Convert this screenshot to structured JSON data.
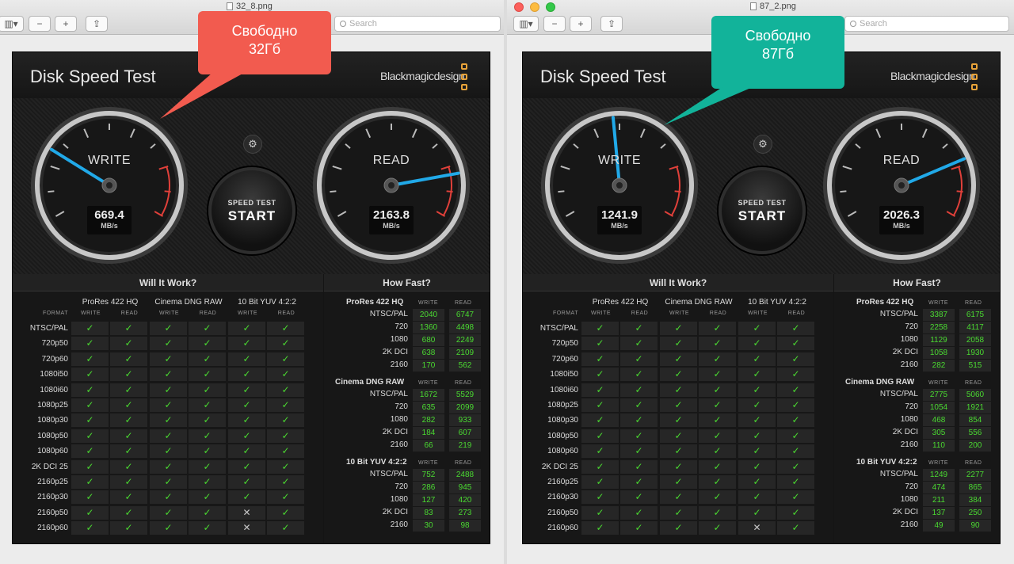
{
  "windows": [
    {
      "filename": "32_8.png",
      "search_placeholder": "Search",
      "traffic_lights": false,
      "app": {
        "title": "Disk Speed Test",
        "brand": "Blackmagicdesign",
        "write": {
          "label": "WRITE",
          "value": "669.4",
          "unit": "MB/s",
          "needle_mbps": 669.4
        },
        "read": {
          "label": "READ",
          "value": "2163.8",
          "unit": "MB/s",
          "needle_mbps": 2163.8
        },
        "start_top": "SPEED TEST",
        "start_main": "START"
      },
      "callout": {
        "line1": "Свободно",
        "line2": "32Гб",
        "color": "#f25b4f"
      },
      "will_it_work": {
        "title": "Will It Work?",
        "groups": [
          "ProRes 422 HQ",
          "Cinema DNG RAW",
          "10 Bit YUV 4:2:2"
        ],
        "format_label": "FORMAT",
        "write_label": "WRITE",
        "read_label": "READ",
        "rows": [
          {
            "label": "NTSC/PAL",
            "cells": [
              1,
              1,
              1,
              1,
              1,
              1
            ]
          },
          {
            "label": "720p50",
            "cells": [
              1,
              1,
              1,
              1,
              1,
              1
            ]
          },
          {
            "label": "720p60",
            "cells": [
              1,
              1,
              1,
              1,
              1,
              1
            ]
          },
          {
            "label": "1080i50",
            "cells": [
              1,
              1,
              1,
              1,
              1,
              1
            ]
          },
          {
            "label": "1080i60",
            "cells": [
              1,
              1,
              1,
              1,
              1,
              1
            ]
          },
          {
            "label": "1080p25",
            "cells": [
              1,
              1,
              1,
              1,
              1,
              1
            ]
          },
          {
            "label": "1080p30",
            "cells": [
              1,
              1,
              1,
              1,
              1,
              1
            ]
          },
          {
            "label": "1080p50",
            "cells": [
              1,
              1,
              1,
              1,
              1,
              1
            ]
          },
          {
            "label": "1080p60",
            "cells": [
              1,
              1,
              1,
              1,
              1,
              1
            ]
          },
          {
            "label": "2K DCI 25",
            "cells": [
              1,
              1,
              1,
              1,
              1,
              1
            ]
          },
          {
            "label": "2160p25",
            "cells": [
              1,
              1,
              1,
              1,
              1,
              1
            ]
          },
          {
            "label": "2160p30",
            "cells": [
              1,
              1,
              1,
              1,
              1,
              1
            ]
          },
          {
            "label": "2160p50",
            "cells": [
              1,
              1,
              1,
              1,
              0,
              1
            ]
          },
          {
            "label": "2160p60",
            "cells": [
              1,
              1,
              1,
              1,
              0,
              1
            ]
          }
        ]
      },
      "how_fast": {
        "title": "How Fast?",
        "groups": [
          {
            "name": "ProRes 422 HQ",
            "rows": [
              [
                "NTSC/PAL",
                "2040",
                "6747"
              ],
              [
                "720",
                "1360",
                "4498"
              ],
              [
                "1080",
                "680",
                "2249"
              ],
              [
                "2K DCI",
                "638",
                "2109"
              ],
              [
                "2160",
                "170",
                "562"
              ]
            ]
          },
          {
            "name": "Cinema DNG RAW",
            "rows": [
              [
                "NTSC/PAL",
                "1672",
                "5529"
              ],
              [
                "720",
                "635",
                "2099"
              ],
              [
                "1080",
                "282",
                "933"
              ],
              [
                "2K DCI",
                "184",
                "607"
              ],
              [
                "2160",
                "66",
                "219"
              ]
            ]
          },
          {
            "name": "10 Bit YUV 4:2:2",
            "rows": [
              [
                "NTSC/PAL",
                "752",
                "2488"
              ],
              [
                "720",
                "286",
                "945"
              ],
              [
                "1080",
                "127",
                "420"
              ],
              [
                "2K DCI",
                "83",
                "273"
              ],
              [
                "2160",
                "30",
                "98"
              ]
            ]
          }
        ]
      }
    },
    {
      "filename": "87_2.png",
      "search_placeholder": "Search",
      "traffic_lights": true,
      "app": {
        "title": "Disk Speed Test",
        "brand": "Blackmagicdesign",
        "write": {
          "label": "WRITE",
          "value": "1241.9",
          "unit": "MB/s",
          "needle_mbps": 1241.9
        },
        "read": {
          "label": "READ",
          "value": "2026.3",
          "unit": "MB/s",
          "needle_mbps": 2026.3
        },
        "start_top": "SPEED TEST",
        "start_main": "START"
      },
      "callout": {
        "line1": "Свободно",
        "line2": "87Гб",
        "color": "#12b39a"
      },
      "will_it_work": {
        "title": "Will It Work?",
        "groups": [
          "ProRes 422 HQ",
          "Cinema DNG RAW",
          "10 Bit YUV 4:2:2"
        ],
        "format_label": "FORMAT",
        "write_label": "WRITE",
        "read_label": "READ",
        "rows": [
          {
            "label": "NTSC/PAL",
            "cells": [
              1,
              1,
              1,
              1,
              1,
              1
            ]
          },
          {
            "label": "720p50",
            "cells": [
              1,
              1,
              1,
              1,
              1,
              1
            ]
          },
          {
            "label": "720p60",
            "cells": [
              1,
              1,
              1,
              1,
              1,
              1
            ]
          },
          {
            "label": "1080i50",
            "cells": [
              1,
              1,
              1,
              1,
              1,
              1
            ]
          },
          {
            "label": "1080i60",
            "cells": [
              1,
              1,
              1,
              1,
              1,
              1
            ]
          },
          {
            "label": "1080p25",
            "cells": [
              1,
              1,
              1,
              1,
              1,
              1
            ]
          },
          {
            "label": "1080p30",
            "cells": [
              1,
              1,
              1,
              1,
              1,
              1
            ]
          },
          {
            "label": "1080p50",
            "cells": [
              1,
              1,
              1,
              1,
              1,
              1
            ]
          },
          {
            "label": "1080p60",
            "cells": [
              1,
              1,
              1,
              1,
              1,
              1
            ]
          },
          {
            "label": "2K DCI 25",
            "cells": [
              1,
              1,
              1,
              1,
              1,
              1
            ]
          },
          {
            "label": "2160p25",
            "cells": [
              1,
              1,
              1,
              1,
              1,
              1
            ]
          },
          {
            "label": "2160p30",
            "cells": [
              1,
              1,
              1,
              1,
              1,
              1
            ]
          },
          {
            "label": "2160p50",
            "cells": [
              1,
              1,
              1,
              1,
              1,
              1
            ]
          },
          {
            "label": "2160p60",
            "cells": [
              1,
              1,
              1,
              1,
              0,
              1
            ]
          }
        ]
      },
      "how_fast": {
        "title": "How Fast?",
        "groups": [
          {
            "name": "ProRes 422 HQ",
            "rows": [
              [
                "NTSC/PAL",
                "3387",
                "6175"
              ],
              [
                "720",
                "2258",
                "4117"
              ],
              [
                "1080",
                "1129",
                "2058"
              ],
              [
                "2K DCI",
                "1058",
                "1930"
              ],
              [
                "2160",
                "282",
                "515"
              ]
            ]
          },
          {
            "name": "Cinema DNG RAW",
            "rows": [
              [
                "NTSC/PAL",
                "2775",
                "5060"
              ],
              [
                "720",
                "1054",
                "1921"
              ],
              [
                "1080",
                "468",
                "854"
              ],
              [
                "2K DCI",
                "305",
                "556"
              ],
              [
                "2160",
                "110",
                "200"
              ]
            ]
          },
          {
            "name": "10 Bit YUV 4:2:2",
            "rows": [
              [
                "NTSC/PAL",
                "1249",
                "2277"
              ],
              [
                "720",
                "474",
                "865"
              ],
              [
                "1080",
                "211",
                "384"
              ],
              [
                "2K DCI",
                "137",
                "250"
              ],
              [
                "2160",
                "49",
                "90"
              ]
            ]
          }
        ]
      }
    }
  ]
}
